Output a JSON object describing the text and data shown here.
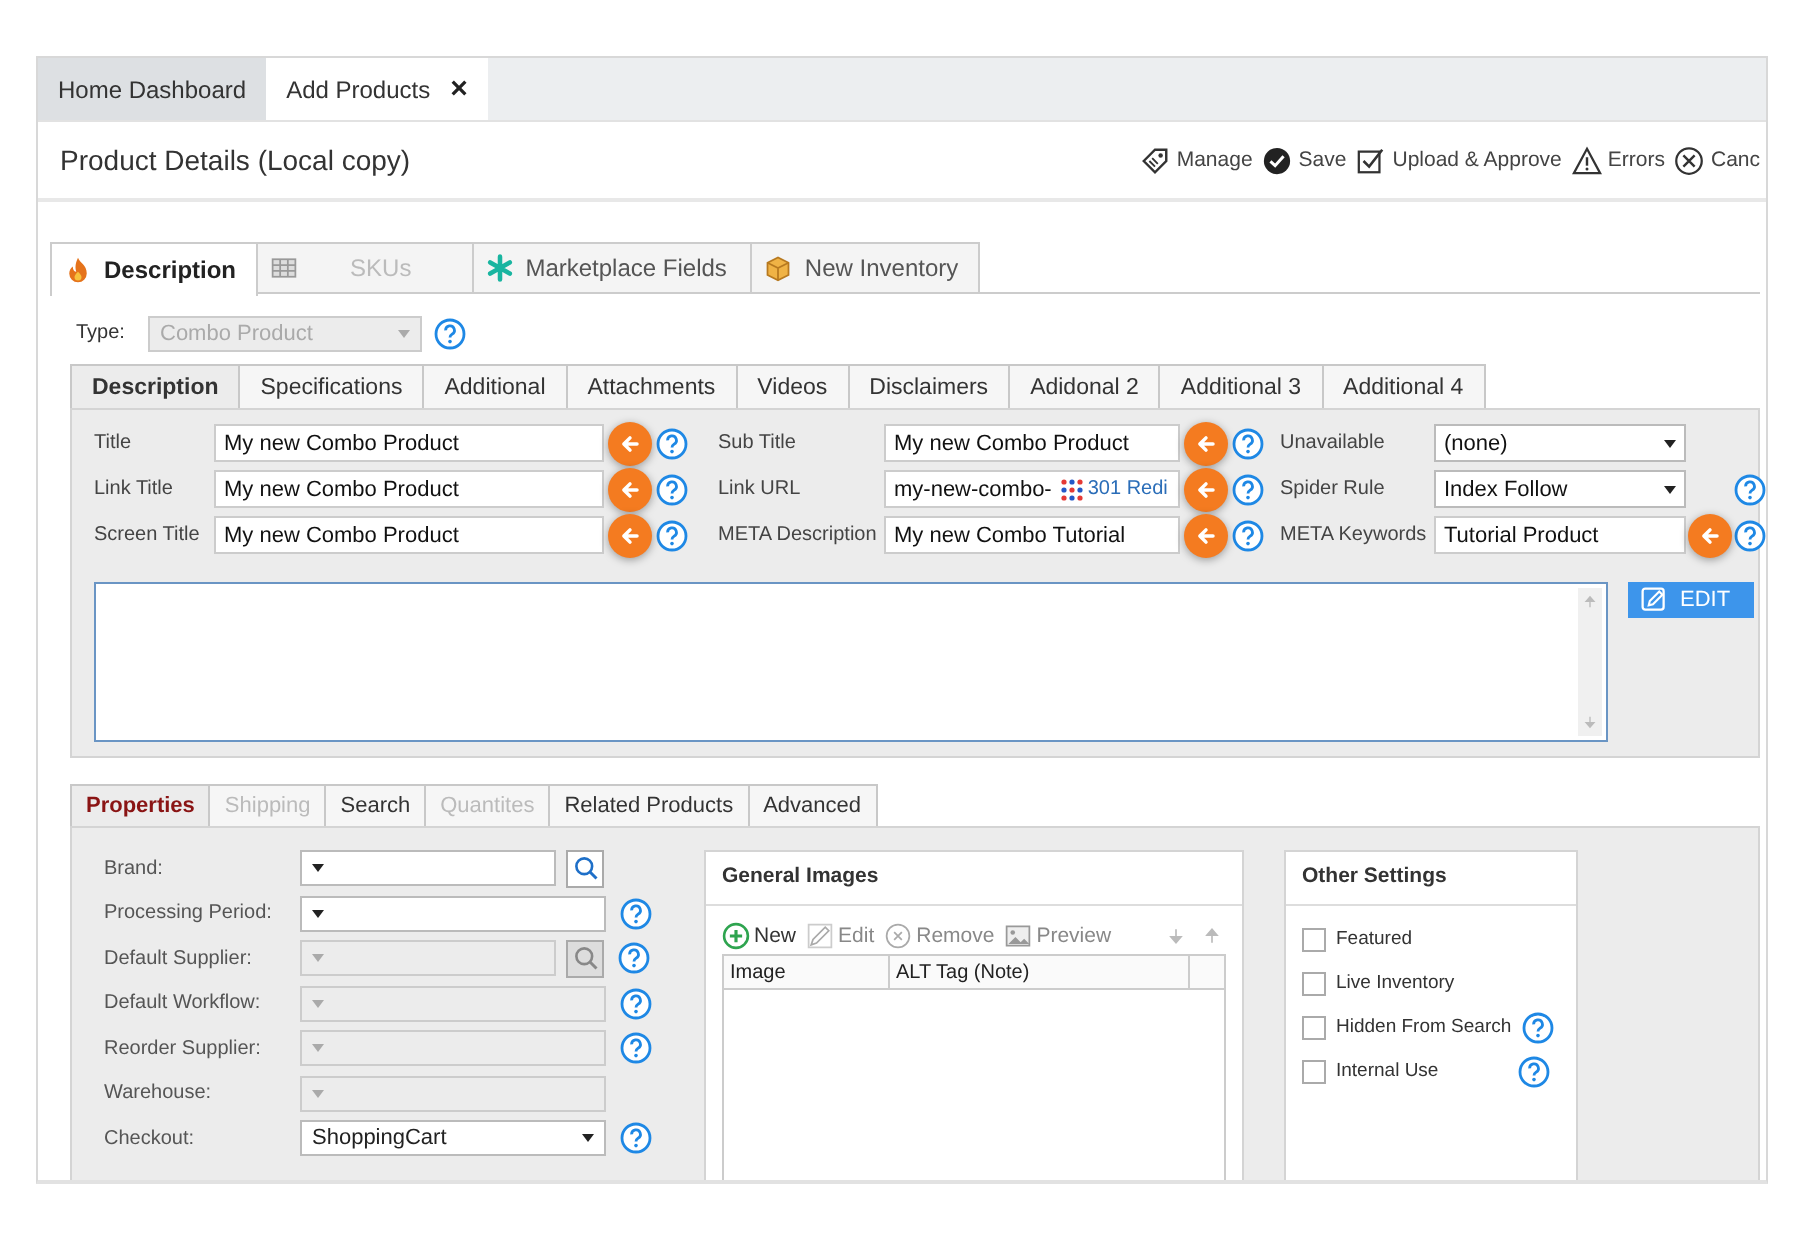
{
  "app_tabs": [
    {
      "label": "Home Dashboard",
      "selected": false
    },
    {
      "label": "Add Products",
      "selected": true,
      "close": "×"
    }
  ],
  "header": {
    "title": "Product Details (Local copy)",
    "actions": [
      {
        "label": "Manage",
        "kind": "tag"
      },
      {
        "label": "Save",
        "kind": "save"
      },
      {
        "label": "Upload & Approve",
        "kind": "approve"
      },
      {
        "label": "Errors",
        "kind": "warning"
      },
      {
        "label": "Canc",
        "kind": "cancel"
      }
    ]
  },
  "main_tabs": [
    {
      "label": "Description",
      "selected": true,
      "disabled": false,
      "kind": "flame"
    },
    {
      "label": "SKUs",
      "selected": false,
      "disabled": true,
      "kind": "grid"
    },
    {
      "label": "Marketplace Fields",
      "selected": false,
      "disabled": false,
      "kind": "asterisk"
    },
    {
      "label": "New Inventory",
      "selected": false,
      "disabled": false,
      "kind": "box"
    }
  ],
  "type_field": {
    "label": "Type:",
    "value": "Combo Product",
    "disabled": true
  },
  "sub_tabs": [
    {
      "label": "Description",
      "selected": true
    },
    {
      "label": "Specifications",
      "selected": false
    },
    {
      "label": "Additional",
      "selected": false
    },
    {
      "label": "Attachments",
      "selected": false
    },
    {
      "label": "Videos",
      "selected": false
    },
    {
      "label": "Disclaimers",
      "selected": false
    },
    {
      "label": "Adidonal 2",
      "selected": false
    },
    {
      "label": "Additional 3",
      "selected": false
    },
    {
      "label": "Additional 4",
      "selected": false
    }
  ],
  "description_fields": [
    {
      "label": "Title",
      "value": "My new Combo Product",
      "kind": "text",
      "copy_button": true,
      "help": true
    },
    {
      "label": "Sub Title",
      "value": "My new Combo Product",
      "kind": "text",
      "copy_button": true,
      "help": true
    },
    {
      "label": "Unavailable",
      "value": "(none)",
      "kind": "select",
      "copy_button": false,
      "help": false
    },
    {
      "label": "Link Title",
      "value": "My new Combo Product",
      "kind": "text",
      "copy_button": true,
      "help": true
    },
    {
      "label": "Link URL",
      "value": "my-new-combo-",
      "kind": "url",
      "badge": "301 Redi",
      "copy_button": true,
      "help": true
    },
    {
      "label": "Spider Rule",
      "value": "Index Follow",
      "kind": "select",
      "copy_button": false,
      "help": true
    },
    {
      "label": "Screen Title",
      "value": "My new Combo Product",
      "kind": "text",
      "copy_button": true,
      "help": true
    },
    {
      "label": "META Description",
      "value": "My new Combo Tutorial",
      "kind": "text",
      "copy_button": true,
      "help": true
    },
    {
      "label": "META Keywords",
      "value": "Tutorial Product",
      "kind": "text",
      "copy_button": true,
      "help": true
    }
  ],
  "editor": {
    "button": "EDIT"
  },
  "bottom_tabs": [
    {
      "label": "Properties",
      "selected": true,
      "disabled": false
    },
    {
      "label": "Shipping",
      "selected": false,
      "disabled": true
    },
    {
      "label": "Search",
      "selected": false,
      "disabled": false
    },
    {
      "label": "Quantites",
      "selected": false,
      "disabled": true
    },
    {
      "label": "Related Products",
      "selected": false,
      "disabled": false
    },
    {
      "label": "Advanced",
      "selected": false,
      "disabled": false
    }
  ],
  "properties": [
    {
      "label": "Brand:",
      "disabled": false,
      "search_button": true,
      "help": false
    },
    {
      "label": "Processing Period:",
      "disabled": false,
      "search_button": false,
      "help": true
    },
    {
      "label": "Default Supplier:",
      "disabled": true,
      "search_button": true,
      "help": true
    },
    {
      "label": "Default Workflow:",
      "disabled": true,
      "search_button": false,
      "help": true
    },
    {
      "label": "Reorder Supplier:",
      "disabled": true,
      "search_button": false,
      "help": true
    },
    {
      "label": "Warehouse:",
      "disabled": true,
      "search_button": false,
      "help": false
    },
    {
      "label": "Checkout:",
      "value": "ShoppingCart",
      "disabled": false,
      "search_button": false,
      "help": true
    }
  ],
  "general_images": {
    "title": "General Images",
    "toolbar": [
      {
        "label": "New",
        "kind": "add",
        "disabled": false
      },
      {
        "label": "Edit",
        "kind": "edit",
        "disabled": true
      },
      {
        "label": "Remove",
        "kind": "remove",
        "disabled": true
      },
      {
        "label": "Preview",
        "kind": "preview",
        "disabled": true
      }
    ],
    "columns": [
      "Image",
      "ALT Tag (Note)"
    ]
  },
  "other_settings": {
    "title": "Other Settings",
    "options": [
      {
        "label": "Featured",
        "checked": false,
        "help": false
      },
      {
        "label": "Live Inventory",
        "checked": false,
        "help": false
      },
      {
        "label": "Hidden From Search",
        "checked": false,
        "help": true
      },
      {
        "label": "Internal Use",
        "checked": false,
        "help": true
      }
    ]
  }
}
